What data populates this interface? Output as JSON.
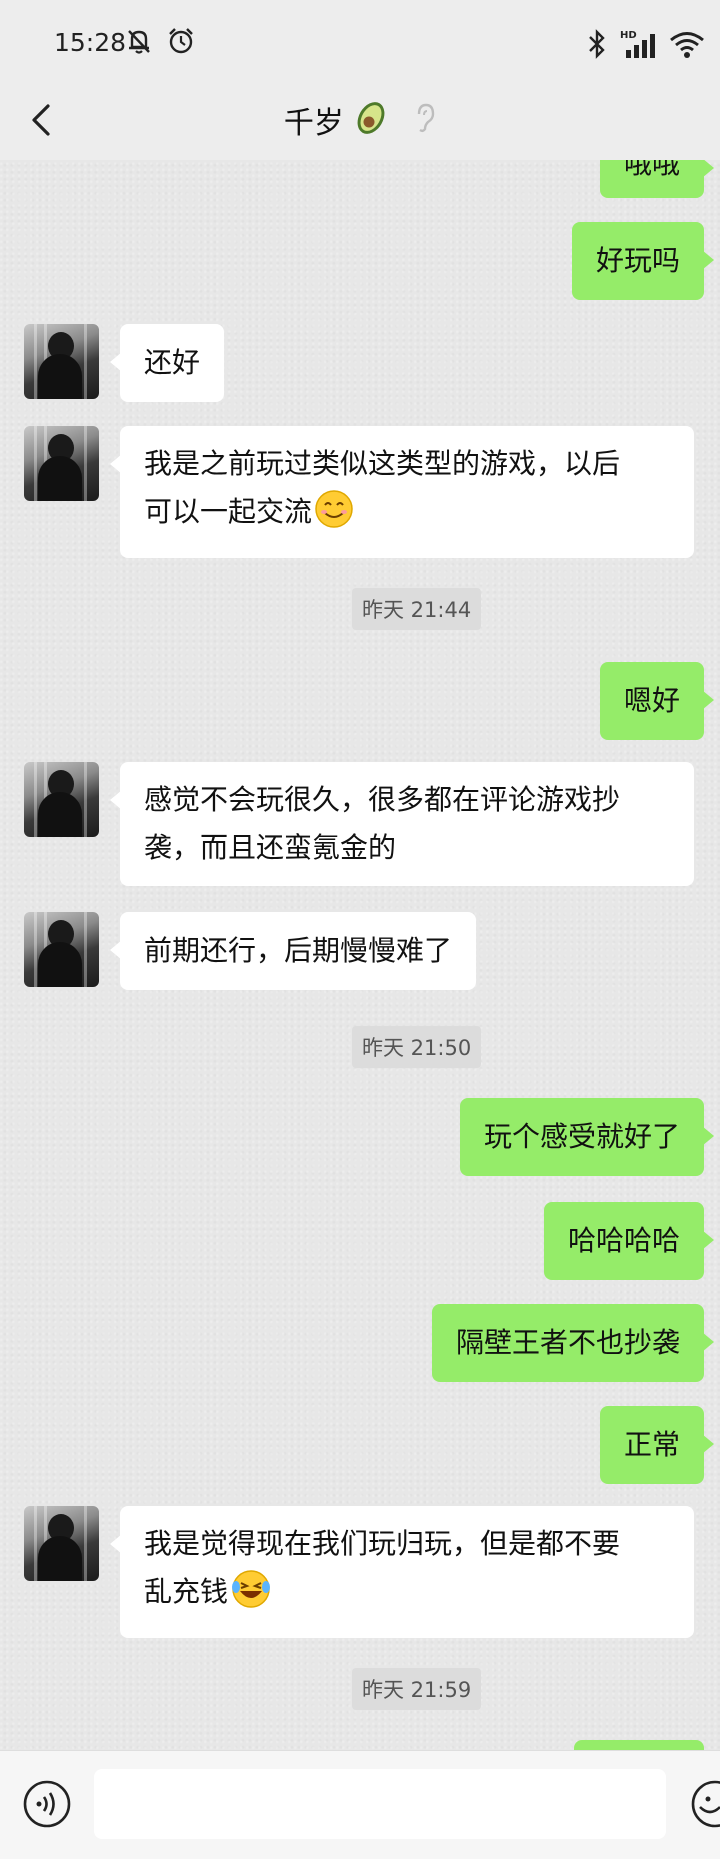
{
  "status_bar": {
    "time": "15:28",
    "network": "HD"
  },
  "header": {
    "title": "千岁"
  },
  "messages": [
    {
      "side": "right",
      "text": "哦哦"
    },
    {
      "side": "right",
      "text": "好玩吗"
    },
    {
      "side": "left",
      "text": "还好"
    },
    {
      "side": "left",
      "line1": "我是之前玩过类似这类型的游戏，以后",
      "line2": "可以一起交流"
    },
    {
      "side": "right",
      "text": "嗯好"
    },
    {
      "side": "left",
      "line1": "感觉不会玩很久，很多都在评论游戏抄",
      "line2": "袭，而且还蛮氪金的"
    },
    {
      "side": "left",
      "text": "前期还行，后期慢慢难了"
    },
    {
      "side": "right",
      "text": "玩个感受就好了"
    },
    {
      "side": "right",
      "text": "哈哈哈哈"
    },
    {
      "side": "right",
      "text": "隔壁王者不也抄袭"
    },
    {
      "side": "right",
      "text": "正常"
    },
    {
      "side": "left",
      "line1": "我是觉得现在我们玩归玩，但是都不要",
      "line2": "乱充钱"
    }
  ],
  "timestamps": [
    "昨天 21:44",
    "昨天 21:50",
    "昨天 21:59"
  ],
  "input": {
    "value": "",
    "placeholder": ""
  },
  "colors": {
    "sent_bubble": "#95ec69",
    "received_bubble": "#ffffff",
    "background": "#e7e7e7"
  },
  "icons": [
    "back-arrow-icon",
    "avocado-icon",
    "ear-icon",
    "voice-icon",
    "emoji-icon",
    "smile-emoji",
    "laugh-tears-emoji",
    "bluetooth-icon",
    "signal-icon",
    "wifi-icon",
    "mute-bell-icon",
    "alarm-icon"
  ]
}
